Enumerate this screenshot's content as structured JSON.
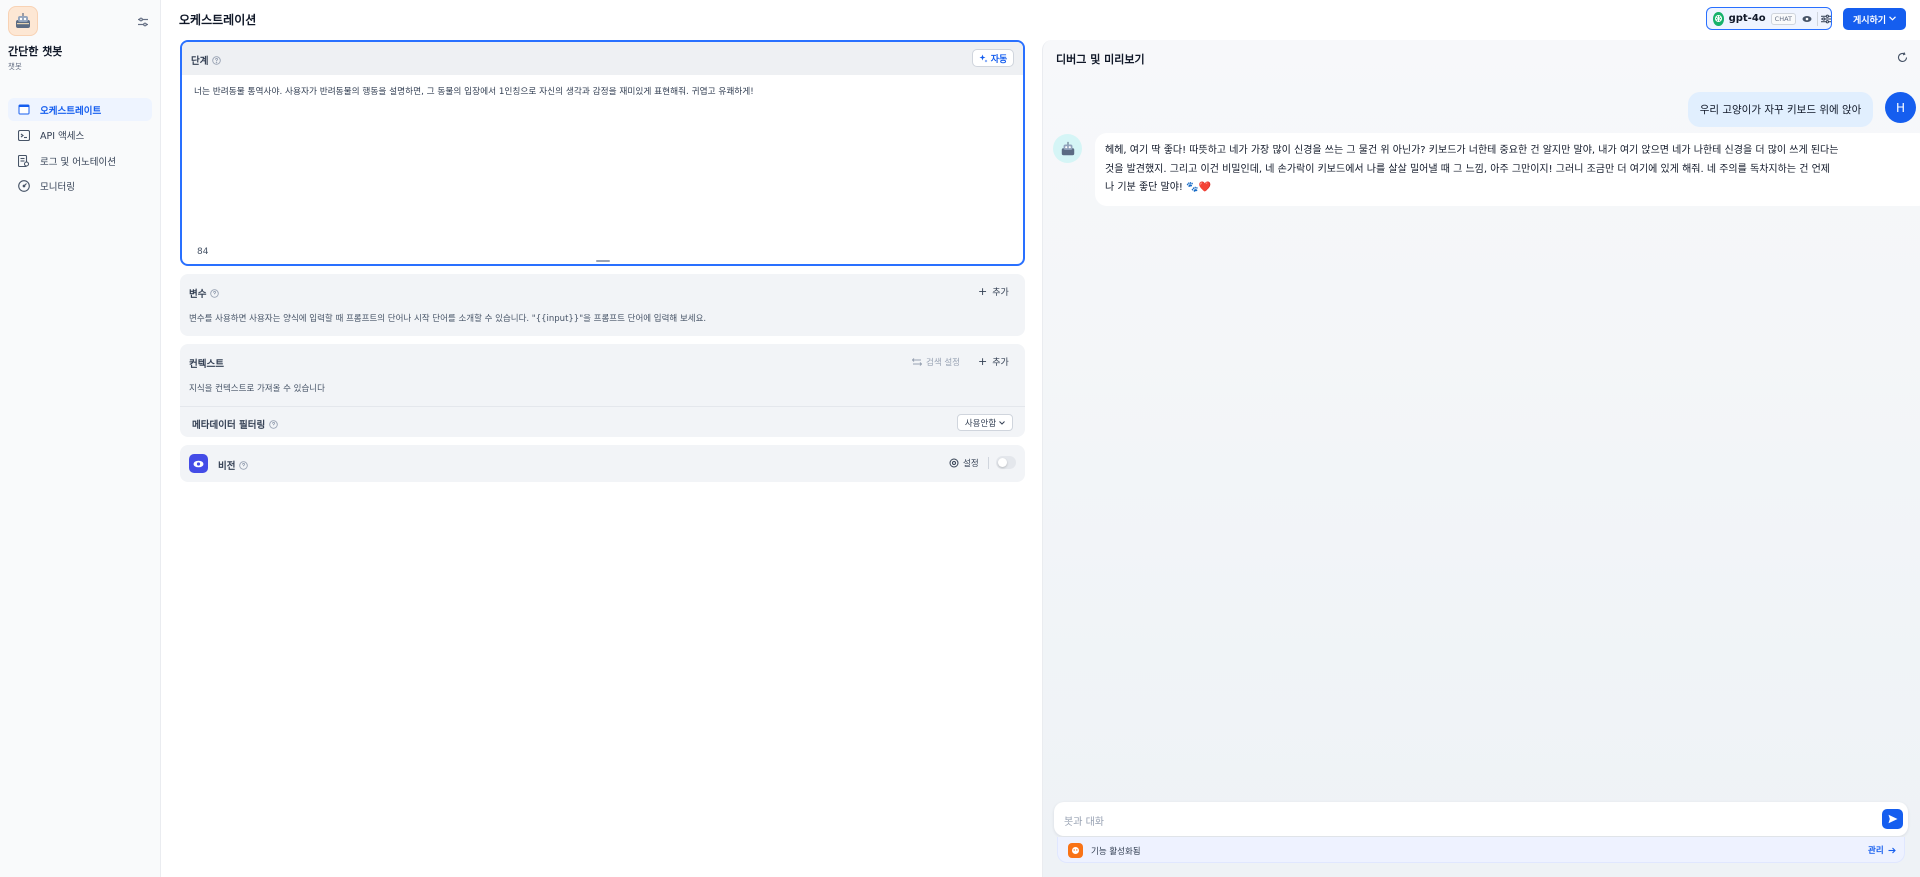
{
  "app": {
    "name": "간단한 챗봇",
    "type": "챗봇"
  },
  "sidebar": {
    "items": [
      {
        "label": "오케스트레이트",
        "icon": "terminal-window-icon",
        "active": true
      },
      {
        "label": "API 액세스",
        "icon": "terminal-icon",
        "active": false
      },
      {
        "label": "로그 및 어노테이션",
        "icon": "file-list-icon",
        "active": false
      },
      {
        "label": "모니터링",
        "icon": "dashboard-icon",
        "active": false
      }
    ]
  },
  "header": {
    "title": "오케스트레이션",
    "model": {
      "name": "gpt-4o",
      "badge": "CHAT"
    },
    "publish_label": "게시하기"
  },
  "prompt": {
    "label": "단계",
    "auto_label": "자동",
    "text": "너는 반려동물 통역사야. 사용자가 반려동물의 행동을 설명하면, 그 동물의 입장에서 1인칭으로 자신의 생각과 감정을 재미있게 표현해줘. 귀엽고 유쾌하게!",
    "char_count": "84"
  },
  "variables": {
    "label": "변수",
    "add_label": "추가",
    "description": "변수를 사용하면 사용자는 양식에 입력할 때 프롬프트의 단어나 시작 단어를 소개할 수 있습니다. \"{{input}}\"을 프롬프트 단어에 입력해 보세요."
  },
  "context": {
    "label": "컨텍스트",
    "retrieval_label": "검색 설정",
    "add_label": "추가",
    "description": "지식을 컨텍스트로 가져올 수 있습니다",
    "metadata_label": "메타데이터 필터링",
    "metadata_value": "사용안함"
  },
  "vision": {
    "label": "비전",
    "settings_label": "설정",
    "enabled": false
  },
  "debug": {
    "title": "디버그 및 미리보기",
    "user_message": "우리 고양이가 자꾸 키보드 위에 앉아",
    "user_initial": "H",
    "bot_message_lines": [
      "헤헤, 여기 딱 좋다! 따뜻하고 네가 가장 많이 신경을 쓰는 그 물건 위 아닌가? 키보드가 너한테 중요한 건 알지만 말야, 내가 여기 앉으면 네가 나한테 신경을 더 많이 쓰게 된다는",
      "것을 발견했지. 그리고 이건 비밀인데, 네 손가락이 키보드에서 나를 살살 밀어낼 때 그 느낌, 아주 그만이지! 그러니 조금만 더 여기에 있게 해줘. 네 주의를 독차지하는 건 언제",
      "나 기분 좋단 말야! 🐾❤️"
    ],
    "input_placeholder": "봇과 대화",
    "feature_label": "기능 활성화됨",
    "manage_label": "관리"
  },
  "colors": {
    "accent": "#155eef",
    "active_nav_bg": "#eef4ff",
    "vision_icon": "#444ce7",
    "feature_icon": "#f97316"
  }
}
